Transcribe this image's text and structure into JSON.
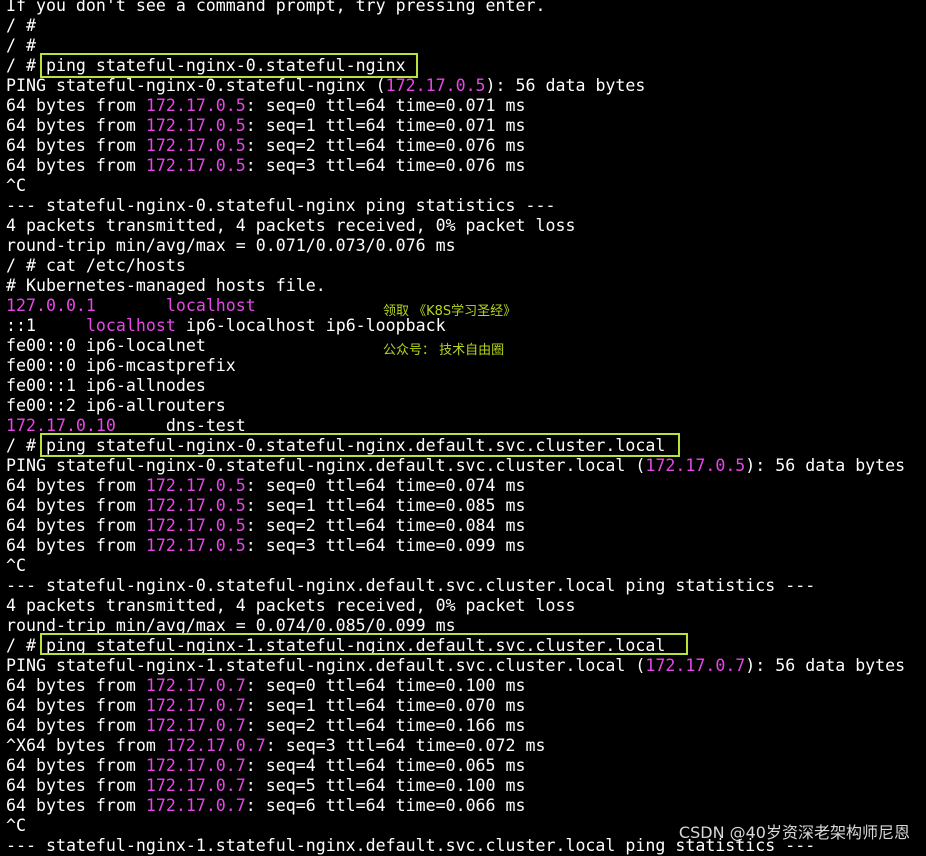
{
  "terminal": {
    "lines": [
      [
        {
          "t": "If you don't see a command prompt, try pressing enter."
        }
      ],
      [
        {
          "t": "/ #"
        }
      ],
      [
        {
          "t": "/ #"
        }
      ],
      [
        {
          "t": "/ # ping stateful-nginx-0.stateful-nginx"
        }
      ],
      [
        {
          "t": "PING stateful-nginx-0.stateful-nginx ("
        },
        {
          "t": "172.17.0.5",
          "ip": true
        },
        {
          "t": "): 56 data bytes"
        }
      ],
      [
        {
          "t": "64 bytes from "
        },
        {
          "t": "172.17.0.5",
          "ip": true
        },
        {
          "t": ": seq=0 ttl=64 time=0.071 ms"
        }
      ],
      [
        {
          "t": "64 bytes from "
        },
        {
          "t": "172.17.0.5",
          "ip": true
        },
        {
          "t": ": seq=1 ttl=64 time=0.071 ms"
        }
      ],
      [
        {
          "t": "64 bytes from "
        },
        {
          "t": "172.17.0.5",
          "ip": true
        },
        {
          "t": ": seq=2 ttl=64 time=0.076 ms"
        }
      ],
      [
        {
          "t": "64 bytes from "
        },
        {
          "t": "172.17.0.5",
          "ip": true
        },
        {
          "t": ": seq=3 ttl=64 time=0.076 ms"
        }
      ],
      [
        {
          "t": "^C"
        }
      ],
      [
        {
          "t": "--- stateful-nginx-0.stateful-nginx ping statistics ---"
        }
      ],
      [
        {
          "t": "4 packets transmitted, 4 packets received, 0% packet loss"
        }
      ],
      [
        {
          "t": "round-trip min/avg/max = 0.071/0.073/0.076 ms"
        }
      ],
      [
        {
          "t": "/ # cat /etc/hosts"
        }
      ],
      [
        {
          "t": "# Kubernetes-managed hosts file."
        }
      ],
      [
        {
          "t": "127.0.0.1",
          "ip": true
        },
        {
          "t": "       "
        },
        {
          "t": "localhost",
          "ip": true
        }
      ],
      [
        {
          "t": "::1     "
        },
        {
          "t": "localhost",
          "ip": true
        },
        {
          "t": " ip6-localhost ip6-loopback"
        }
      ],
      [
        {
          "t": "fe00::0 ip6-localnet"
        }
      ],
      [
        {
          "t": "fe00::0 ip6-mcastprefix"
        }
      ],
      [
        {
          "t": "fe00::1 ip6-allnodes"
        }
      ],
      [
        {
          "t": "fe00::2 ip6-allrouters"
        }
      ],
      [
        {
          "t": "172.17.0.10",
          "ip": true
        },
        {
          "t": "     dns-test"
        }
      ],
      [
        {
          "t": "/ # ping stateful-nginx-0.stateful-nginx.default.svc.cluster.local"
        }
      ],
      [
        {
          "t": "PING stateful-nginx-0.stateful-nginx.default.svc.cluster.local ("
        },
        {
          "t": "172.17.0.5",
          "ip": true
        },
        {
          "t": "): 56 data bytes"
        }
      ],
      [
        {
          "t": "64 bytes from "
        },
        {
          "t": "172.17.0.5",
          "ip": true
        },
        {
          "t": ": seq=0 ttl=64 time=0.074 ms"
        }
      ],
      [
        {
          "t": "64 bytes from "
        },
        {
          "t": "172.17.0.5",
          "ip": true
        },
        {
          "t": ": seq=1 ttl=64 time=0.085 ms"
        }
      ],
      [
        {
          "t": "64 bytes from "
        },
        {
          "t": "172.17.0.5",
          "ip": true
        },
        {
          "t": ": seq=2 ttl=64 time=0.084 ms"
        }
      ],
      [
        {
          "t": "64 bytes from "
        },
        {
          "t": "172.17.0.5",
          "ip": true
        },
        {
          "t": ": seq=3 ttl=64 time=0.099 ms"
        }
      ],
      [
        {
          "t": "^C"
        }
      ],
      [
        {
          "t": "--- stateful-nginx-0.stateful-nginx.default.svc.cluster.local ping statistics ---"
        }
      ],
      [
        {
          "t": "4 packets transmitted, 4 packets received, 0% packet loss"
        }
      ],
      [
        {
          "t": "round-trip min/avg/max = 0.074/0.085/0.099 ms"
        }
      ],
      [
        {
          "t": "/ # ping stateful-nginx-1.stateful-nginx.default.svc.cluster.local"
        }
      ],
      [
        {
          "t": "PING stateful-nginx-1.stateful-nginx.default.svc.cluster.local ("
        },
        {
          "t": "172.17.0.7",
          "ip": true
        },
        {
          "t": "): 56 data bytes"
        }
      ],
      [
        {
          "t": "64 bytes from "
        },
        {
          "t": "172.17.0.7",
          "ip": true
        },
        {
          "t": ": seq=0 ttl=64 time=0.100 ms"
        }
      ],
      [
        {
          "t": "64 bytes from "
        },
        {
          "t": "172.17.0.7",
          "ip": true
        },
        {
          "t": ": seq=1 ttl=64 time=0.070 ms"
        }
      ],
      [
        {
          "t": "64 bytes from "
        },
        {
          "t": "172.17.0.7",
          "ip": true
        },
        {
          "t": ": seq=2 ttl=64 time=0.166 ms"
        }
      ],
      [
        {
          "t": "^X64 bytes from "
        },
        {
          "t": "172.17.0.7",
          "ip": true
        },
        {
          "t": ": seq=3 ttl=64 time=0.072 ms"
        }
      ],
      [
        {
          "t": "64 bytes from "
        },
        {
          "t": "172.17.0.7",
          "ip": true
        },
        {
          "t": ": seq=4 ttl=64 time=0.065 ms"
        }
      ],
      [
        {
          "t": "64 bytes from "
        },
        {
          "t": "172.17.0.7",
          "ip": true
        },
        {
          "t": ": seq=5 ttl=64 time=0.100 ms"
        }
      ],
      [
        {
          "t": "64 bytes from "
        },
        {
          "t": "172.17.0.7",
          "ip": true
        },
        {
          "t": ": seq=6 ttl=64 time=0.066 ms"
        }
      ],
      [
        {
          "t": "^C"
        }
      ],
      [
        {
          "t": "--- stateful-nginx-1.stateful-nginx.default.svc.cluster.local ping statistics ---"
        }
      ]
    ]
  },
  "overlay": {
    "line1": "领取 《K8S学习圣经》",
    "line2": "公众号：  技术自由圈"
  },
  "watermark": "CSDN @40岁资深老架构师尼恩",
  "colors": {
    "background": "#000000",
    "text": "#ffffff",
    "ip_highlight": "#e646e6",
    "box_highlight": "#b9e23a",
    "overlay_text": "#b7d51d"
  }
}
